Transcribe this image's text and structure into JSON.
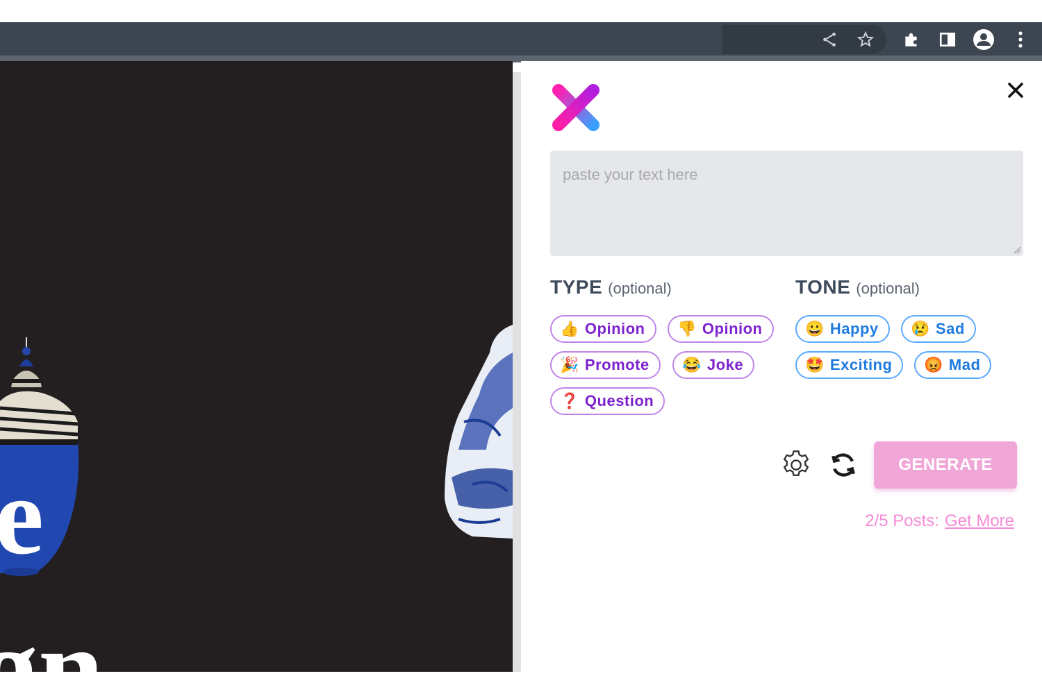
{
  "browser": {
    "toolbar_icons": [
      "share-icon",
      "star-icon",
      "extensions-icon",
      "side-panel-icon",
      "profile-icon",
      "more-menu-icon"
    ]
  },
  "background_page": {
    "large_text": [
      "e",
      "gn"
    ]
  },
  "extension": {
    "textarea": {
      "placeholder": "paste your text here",
      "value": ""
    },
    "type_section": {
      "title": "TYPE",
      "optional": "(optional)",
      "chips": [
        {
          "emoji": "👍",
          "label": "Opinion"
        },
        {
          "emoji": "👎",
          "label": "Opinion"
        },
        {
          "emoji": "🎉",
          "label": "Promote"
        },
        {
          "emoji": "😂",
          "label": "Joke"
        },
        {
          "emoji": "❓",
          "label": "Question"
        }
      ]
    },
    "tone_section": {
      "title": "TONE",
      "optional": "(optional)",
      "chips": [
        {
          "emoji": "😀",
          "label": "Happy"
        },
        {
          "emoji": "😢",
          "label": "Sad"
        },
        {
          "emoji": "🤩",
          "label": "Exciting"
        },
        {
          "emoji": "😡",
          "label": "Mad"
        }
      ]
    },
    "generate_label": "GENERATE",
    "posts_status": "2/5 Posts:",
    "get_more_label": "Get More",
    "colors": {
      "type_chip": "#7e22ce",
      "tone_chip": "#1f7ae0",
      "generate_bg": "#f0a7d8",
      "posts_text": "#f58ad6"
    }
  }
}
